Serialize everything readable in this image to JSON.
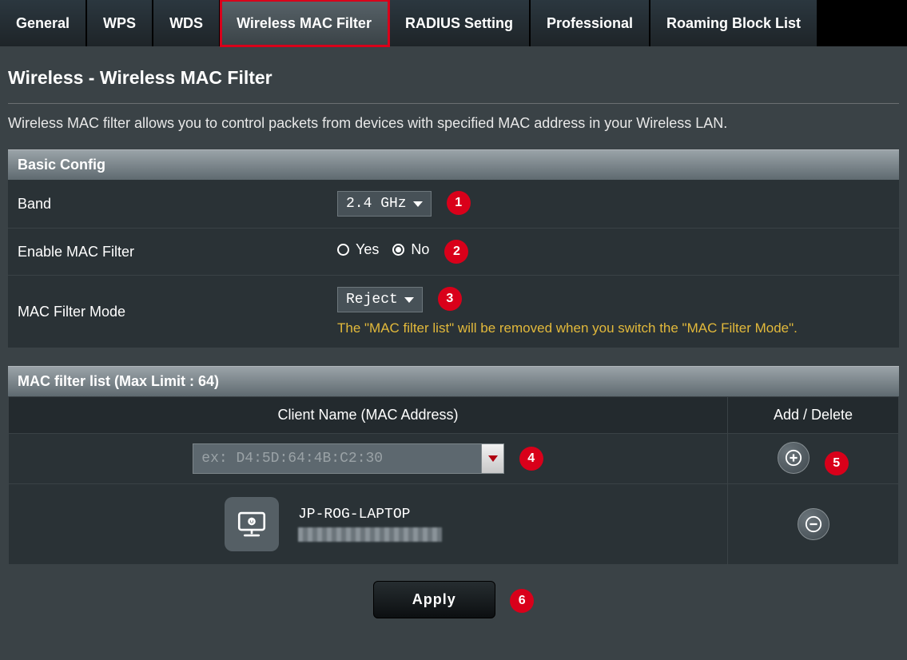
{
  "tabs": [
    {
      "label": "General"
    },
    {
      "label": "WPS"
    },
    {
      "label": "WDS"
    },
    {
      "label": "Wireless MAC Filter",
      "active": true
    },
    {
      "label": "RADIUS Setting"
    },
    {
      "label": "Professional"
    },
    {
      "label": "Roaming Block List"
    }
  ],
  "page": {
    "title": "Wireless - Wireless MAC Filter",
    "description": "Wireless MAC filter allows you to control packets from devices with specified MAC address in your Wireless LAN."
  },
  "basic": {
    "section_title": "Basic Config",
    "band_label": "Band",
    "band_value": "2.4 GHz",
    "enable_label": "Enable MAC Filter",
    "enable_yes": "Yes",
    "enable_no": "No",
    "enable_selected": "No",
    "mode_label": "MAC Filter Mode",
    "mode_value": "Reject",
    "mode_hint": "The \"MAC filter list\" will be removed when you switch the \"MAC Filter Mode\"."
  },
  "filter_list": {
    "section_title": "MAC filter list (Max Limit : 64)",
    "col_client": "Client Name (MAC Address)",
    "col_action": "Add / Delete",
    "input_placeholder": "ex: D4:5D:64:4B:C2:30",
    "rows": [
      {
        "name": "JP-ROG-LAPTOP"
      }
    ]
  },
  "steps": {
    "s1": "1",
    "s2": "2",
    "s3": "3",
    "s4": "4",
    "s5": "5",
    "s6": "6"
  },
  "apply_label": "Apply"
}
